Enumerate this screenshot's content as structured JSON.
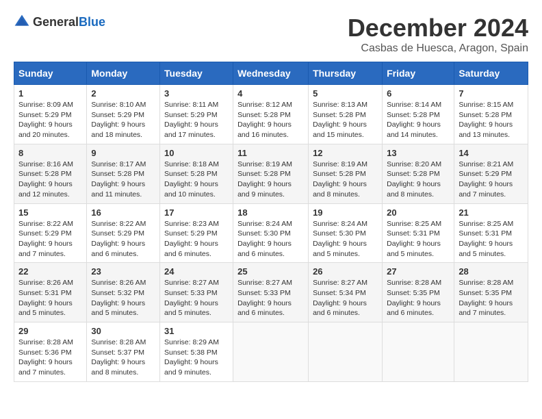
{
  "header": {
    "logo_general": "General",
    "logo_blue": "Blue",
    "month_title": "December 2024",
    "location": "Casbas de Huesca, Aragon, Spain"
  },
  "weekdays": [
    "Sunday",
    "Monday",
    "Tuesday",
    "Wednesday",
    "Thursday",
    "Friday",
    "Saturday"
  ],
  "weeks": [
    [
      {
        "day": "1",
        "sunrise": "8:09 AM",
        "sunset": "5:29 PM",
        "daylight": "9 hours and 20 minutes."
      },
      {
        "day": "2",
        "sunrise": "8:10 AM",
        "sunset": "5:29 PM",
        "daylight": "9 hours and 18 minutes."
      },
      {
        "day": "3",
        "sunrise": "8:11 AM",
        "sunset": "5:29 PM",
        "daylight": "9 hours and 17 minutes."
      },
      {
        "day": "4",
        "sunrise": "8:12 AM",
        "sunset": "5:28 PM",
        "daylight": "9 hours and 16 minutes."
      },
      {
        "day": "5",
        "sunrise": "8:13 AM",
        "sunset": "5:28 PM",
        "daylight": "9 hours and 15 minutes."
      },
      {
        "day": "6",
        "sunrise": "8:14 AM",
        "sunset": "5:28 PM",
        "daylight": "9 hours and 14 minutes."
      },
      {
        "day": "7",
        "sunrise": "8:15 AM",
        "sunset": "5:28 PM",
        "daylight": "9 hours and 13 minutes."
      }
    ],
    [
      {
        "day": "8",
        "sunrise": "8:16 AM",
        "sunset": "5:28 PM",
        "daylight": "9 hours and 12 minutes."
      },
      {
        "day": "9",
        "sunrise": "8:17 AM",
        "sunset": "5:28 PM",
        "daylight": "9 hours and 11 minutes."
      },
      {
        "day": "10",
        "sunrise": "8:18 AM",
        "sunset": "5:28 PM",
        "daylight": "9 hours and 10 minutes."
      },
      {
        "day": "11",
        "sunrise": "8:19 AM",
        "sunset": "5:28 PM",
        "daylight": "9 hours and 9 minutes."
      },
      {
        "day": "12",
        "sunrise": "8:19 AM",
        "sunset": "5:28 PM",
        "daylight": "9 hours and 8 minutes."
      },
      {
        "day": "13",
        "sunrise": "8:20 AM",
        "sunset": "5:28 PM",
        "daylight": "9 hours and 8 minutes."
      },
      {
        "day": "14",
        "sunrise": "8:21 AM",
        "sunset": "5:29 PM",
        "daylight": "9 hours and 7 minutes."
      }
    ],
    [
      {
        "day": "15",
        "sunrise": "8:22 AM",
        "sunset": "5:29 PM",
        "daylight": "9 hours and 7 minutes."
      },
      {
        "day": "16",
        "sunrise": "8:22 AM",
        "sunset": "5:29 PM",
        "daylight": "9 hours and 6 minutes."
      },
      {
        "day": "17",
        "sunrise": "8:23 AM",
        "sunset": "5:29 PM",
        "daylight": "9 hours and 6 minutes."
      },
      {
        "day": "18",
        "sunrise": "8:24 AM",
        "sunset": "5:30 PM",
        "daylight": "9 hours and 6 minutes."
      },
      {
        "day": "19",
        "sunrise": "8:24 AM",
        "sunset": "5:30 PM",
        "daylight": "9 hours and 5 minutes."
      },
      {
        "day": "20",
        "sunrise": "8:25 AM",
        "sunset": "5:31 PM",
        "daylight": "9 hours and 5 minutes."
      },
      {
        "day": "21",
        "sunrise": "8:25 AM",
        "sunset": "5:31 PM",
        "daylight": "9 hours and 5 minutes."
      }
    ],
    [
      {
        "day": "22",
        "sunrise": "8:26 AM",
        "sunset": "5:31 PM",
        "daylight": "9 hours and 5 minutes."
      },
      {
        "day": "23",
        "sunrise": "8:26 AM",
        "sunset": "5:32 PM",
        "daylight": "9 hours and 5 minutes."
      },
      {
        "day": "24",
        "sunrise": "8:27 AM",
        "sunset": "5:33 PM",
        "daylight": "9 hours and 5 minutes."
      },
      {
        "day": "25",
        "sunrise": "8:27 AM",
        "sunset": "5:33 PM",
        "daylight": "9 hours and 6 minutes."
      },
      {
        "day": "26",
        "sunrise": "8:27 AM",
        "sunset": "5:34 PM",
        "daylight": "9 hours and 6 minutes."
      },
      {
        "day": "27",
        "sunrise": "8:28 AM",
        "sunset": "5:35 PM",
        "daylight": "9 hours and 6 minutes."
      },
      {
        "day": "28",
        "sunrise": "8:28 AM",
        "sunset": "5:35 PM",
        "daylight": "9 hours and 7 minutes."
      }
    ],
    [
      {
        "day": "29",
        "sunrise": "8:28 AM",
        "sunset": "5:36 PM",
        "daylight": "9 hours and 7 minutes."
      },
      {
        "day": "30",
        "sunrise": "8:28 AM",
        "sunset": "5:37 PM",
        "daylight": "9 hours and 8 minutes."
      },
      {
        "day": "31",
        "sunrise": "8:29 AM",
        "sunset": "5:38 PM",
        "daylight": "9 hours and 9 minutes."
      },
      null,
      null,
      null,
      null
    ]
  ],
  "labels": {
    "sunrise": "Sunrise:",
    "sunset": "Sunset:",
    "daylight": "Daylight:"
  }
}
